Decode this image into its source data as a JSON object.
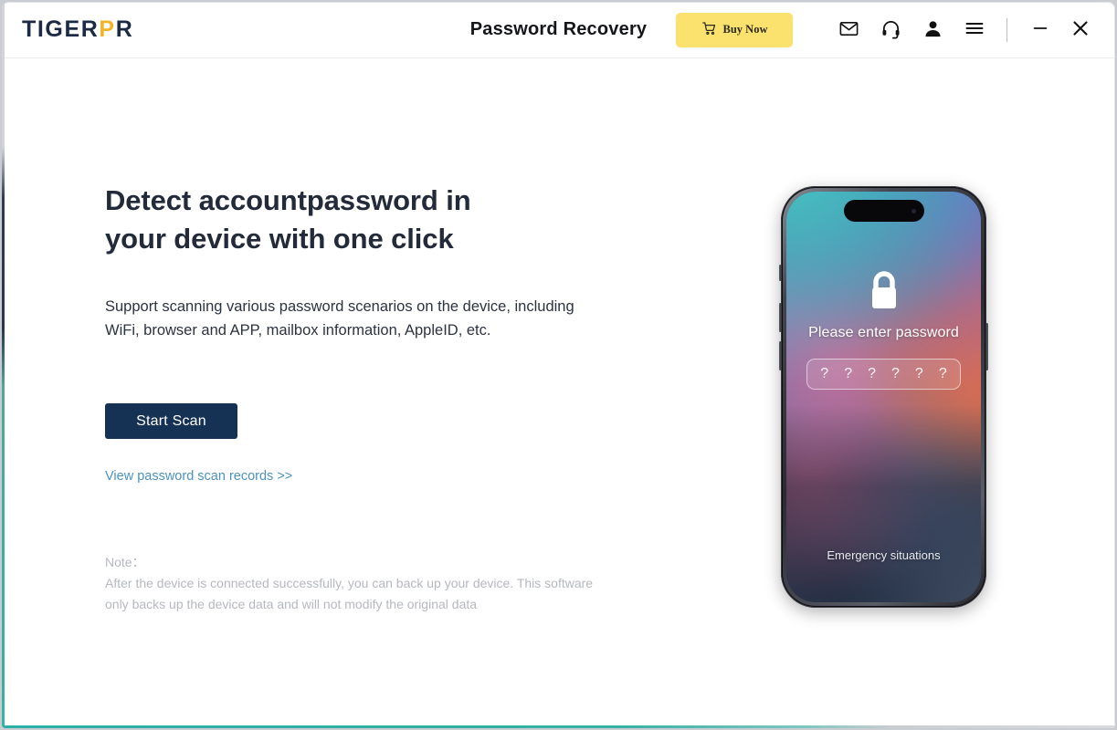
{
  "window": {
    "brand_main": "TIGER",
    "brand_accent": "P",
    "brand_tail": "R",
    "title": "Password Recovery",
    "accent_color": "#f0b429",
    "frame_accent_teal": "#35b2a8",
    "frame_accent_navy": "#2f3a55"
  },
  "titlebar": {
    "buy_now_label": "Buy Now",
    "buy_now_bg": "#fbe26f",
    "icons": {
      "mail": "mail-icon",
      "support": "headset-icon",
      "account": "user-icon",
      "menu": "hamburger-menu-icon",
      "minimize": "minimize-icon",
      "close": "close-icon"
    }
  },
  "main": {
    "headline_line1": "Detect accountpassword in",
    "headline_line2": "your device with one click",
    "subtext_line1": "Support scanning various password scenarios on the device, including",
    "subtext_line2": "WiFi, browser and APP, mailbox information, AppleID, etc.",
    "start_scan_label": "Start Scan",
    "start_scan_bg": "#153255",
    "records_link_label": "View password scan records >>",
    "records_link_color": "#4b92bf",
    "note_title": "Note：",
    "note_line1": "After the device is connected successfully, you can back up your device. This software",
    "note_line2": "only backs up the device data and will not modify the original data"
  },
  "phone": {
    "lock_icon": "lock-icon",
    "prompt": "Please enter password",
    "password_chars": [
      "?",
      "?",
      "?",
      "?",
      "?",
      "?"
    ],
    "emergency_label": "Emergency situations"
  }
}
